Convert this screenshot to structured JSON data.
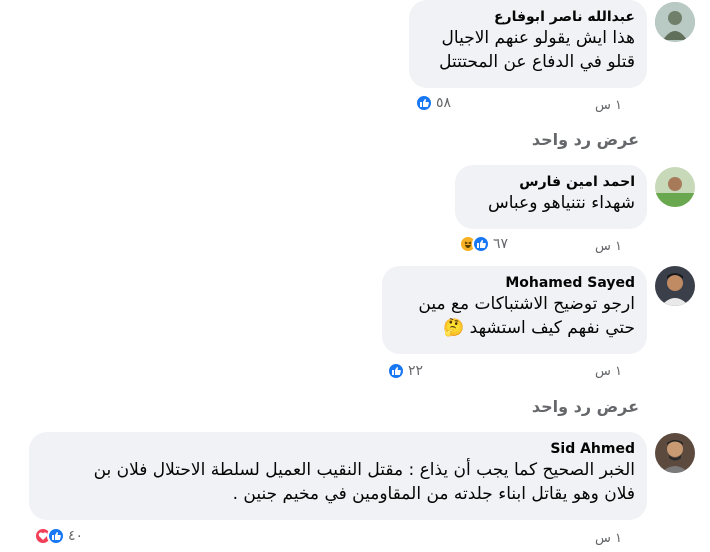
{
  "comments": [
    {
      "author": "عبدالله ناصر ابوفارع",
      "lines": [
        "هذا ايش يقولو عنهم الاجيال",
        "قتلو في الدفاع عن المحتتتل"
      ],
      "time": "١ س",
      "reaction_count": "٥٨",
      "reactions": [
        "like-icon"
      ]
    },
    {
      "author": "احمد امين فارس",
      "lines": [
        "شهداء نتنياهو وعباس"
      ],
      "time": "١ س",
      "reaction_count": "٦٧",
      "reactions": [
        "haha-icon",
        "like-icon"
      ]
    },
    {
      "author": "Mohamed Sayed",
      "lines": [
        "ارجو توضيح الاشتباكات مع مين",
        "حتي نفهم كيف استشهد"
      ],
      "emoji": "🤔",
      "time": "١ س",
      "reaction_count": "٢٢",
      "reactions": [
        "like-icon"
      ]
    },
    {
      "author": "Sid Ahmed",
      "lines": [
        "الخبر الصحيح كما يجب أن يذاع : مقتل النقيب العميل لسلطة الاحتلال فلان بن",
        "فلان وهو يقاتل ابناء جلدته من المقاومين في مخيم جنين ."
      ],
      "time": "١ س",
      "reaction_count": "٤٠",
      "reactions": [
        "love-icon",
        "like-icon"
      ]
    }
  ],
  "view_reply_label": "عرض رد واحد",
  "colors": {
    "like": "#1877f2",
    "love": "#f33e58",
    "haha": "#f7b125",
    "bubble": "#f0f2f5",
    "meta": "#65676b"
  }
}
